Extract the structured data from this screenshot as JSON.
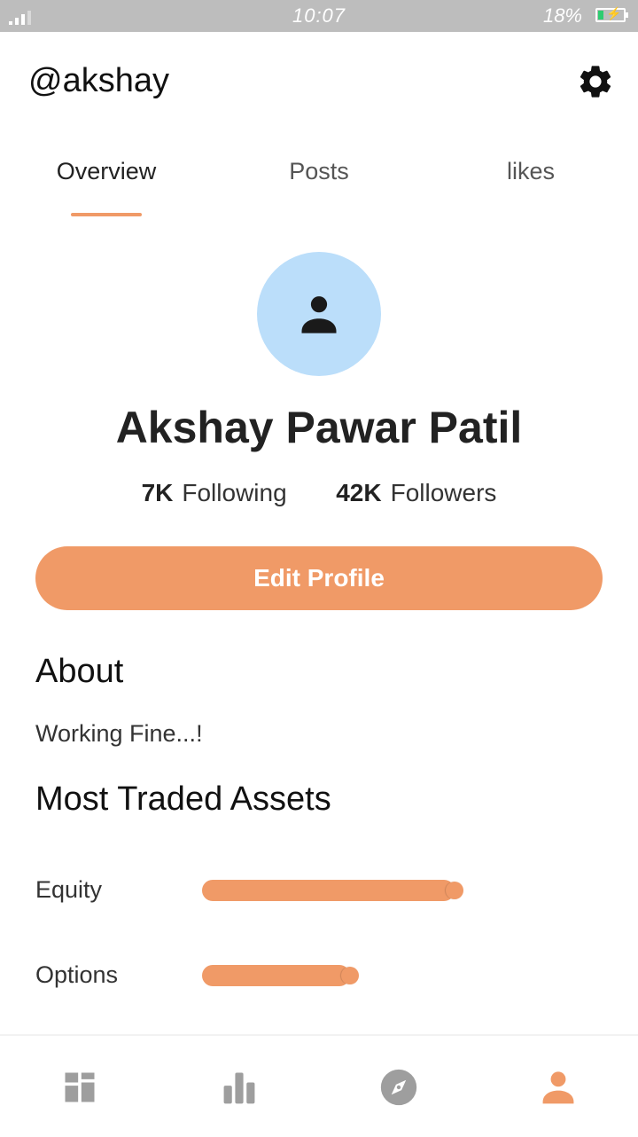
{
  "status_bar": {
    "time": "10:07",
    "battery": "18%"
  },
  "header": {
    "username": "@akshay",
    "settings_icon": "gear-icon"
  },
  "tabs": [
    {
      "label": "Overview",
      "active": true
    },
    {
      "label": "Posts",
      "active": false
    },
    {
      "label": "likes",
      "active": false
    }
  ],
  "profile": {
    "avatar_icon": "person-icon",
    "name": "Akshay Pawar Patil",
    "following_count": "7K",
    "following_label": "Following",
    "followers_count": "42K",
    "followers_label": "Followers",
    "edit_button": "Edit Profile"
  },
  "about": {
    "title": "About",
    "text": "Working Fine...!"
  },
  "assets": {
    "title": "Most Traded Assets",
    "items": [
      {
        "label": "Equity",
        "value": 0.58
      },
      {
        "label": "Options",
        "value": 0.34
      }
    ]
  },
  "bottom_nav": [
    {
      "icon": "dashboard-icon",
      "active": false
    },
    {
      "icon": "bar-chart-icon",
      "active": false
    },
    {
      "icon": "compass-icon",
      "active": false
    },
    {
      "icon": "person-icon",
      "active": true
    }
  ],
  "colors": {
    "accent": "#f09a67",
    "avatar_bg": "#bbdefa",
    "status_bar": "#bdbdbd",
    "nav_inactive": "#9e9e9e"
  }
}
